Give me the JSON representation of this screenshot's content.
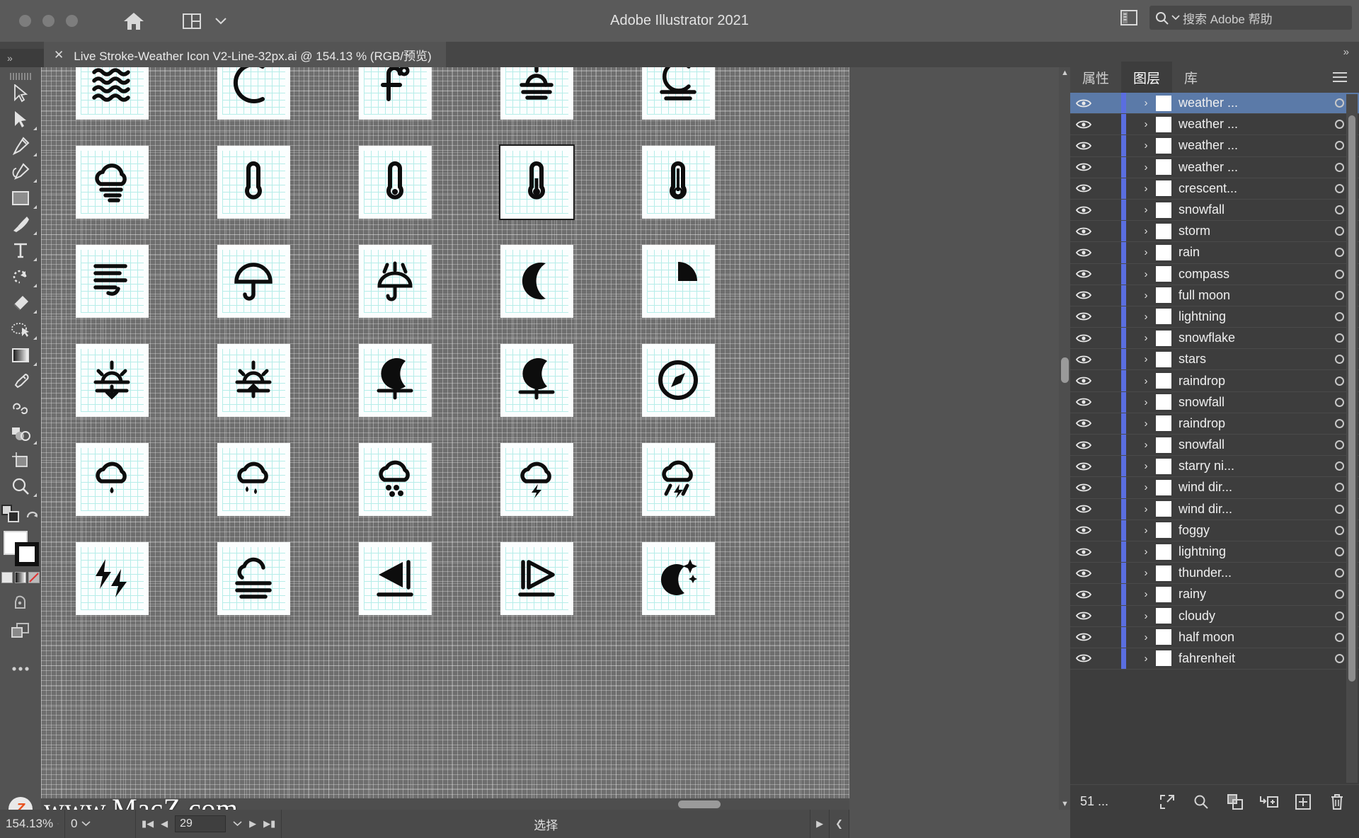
{
  "window": {
    "app_title": "Adobe Illustrator 2021",
    "traffic_lights": [
      "close",
      "minimize",
      "maximize"
    ],
    "home_icon": "home-icon",
    "arrange_icon": "arrange-documents-icon",
    "arrange_chevron": "chevron-down-icon",
    "panel_toggle_icon": "panel-toggle-icon"
  },
  "search": {
    "icon": "search-icon",
    "chevron": "chevron-down-icon",
    "placeholder": "搜索 Adobe 帮助"
  },
  "tabbar": {
    "collapse_label": "»",
    "document": {
      "close_icon": "close-icon",
      "title": "Live Stroke-Weather Icon V2-Line-32px.ai @ 154.13 % (RGB/预览)"
    }
  },
  "toolbar": {
    "tools": [
      {
        "name": "selection-tool",
        "glyph": "cursor",
        "has_flyout": false,
        "selected": false
      },
      {
        "name": "direct-selection-tool",
        "glyph": "cursor-filled",
        "has_flyout": true,
        "selected": false
      },
      {
        "name": "pen-tool",
        "glyph": "pen",
        "has_flyout": true,
        "selected": false
      },
      {
        "name": "curvature-tool",
        "glyph": "curvature",
        "has_flyout": true,
        "selected": false
      },
      {
        "name": "rectangle-tool",
        "glyph": "rectangle",
        "has_flyout": true,
        "selected": false
      },
      {
        "name": "paintbrush-tool",
        "glyph": "brush",
        "has_flyout": true,
        "selected": false
      },
      {
        "name": "type-tool",
        "glyph": "type",
        "has_flyout": true,
        "selected": false
      },
      {
        "name": "rotate-tool",
        "glyph": "rotate",
        "has_flyout": true,
        "selected": false
      },
      {
        "name": "eraser-tool",
        "glyph": "eraser",
        "has_flyout": true,
        "selected": false
      },
      {
        "name": "shaper-tool",
        "glyph": "shaper",
        "has_flyout": true,
        "selected": false
      },
      {
        "name": "gradient-tool",
        "glyph": "gradient",
        "has_flyout": true,
        "selected": false
      },
      {
        "name": "eyedropper-tool",
        "glyph": "eyedropper",
        "has_flyout": false,
        "selected": false
      },
      {
        "name": "blend-tool",
        "glyph": "blend",
        "has_flyout": false,
        "selected": false
      },
      {
        "name": "shape-builder-tool",
        "glyph": "shapebuilder",
        "has_flyout": true,
        "selected": false
      },
      {
        "name": "artboard-tool",
        "glyph": "artboard",
        "has_flyout": false,
        "selected": false
      },
      {
        "name": "zoom-tool",
        "glyph": "zoom",
        "has_flyout": true,
        "selected": false
      }
    ],
    "screen_mode_icon": "screen-mode-icon",
    "swap_icon": "swap-fill-stroke-icon",
    "fill_color": "#ffffff",
    "stroke_color": "#111111",
    "more_tools_icon": "more-tools-icon",
    "drawing_mode_icon": "drawing-mode-icon"
  },
  "canvas": {
    "icon_rows": [
      [
        {
          "name": "waves-icon",
          "glyph": "waves",
          "selected": false
        },
        {
          "name": "crescent-outline-icon",
          "glyph": "crescent-c",
          "selected": false
        },
        {
          "name": "fahrenheit-icon",
          "glyph": "fahrenheit",
          "selected": false
        },
        {
          "name": "sunrise-fog-icon",
          "glyph": "sun-lines",
          "selected": false
        },
        {
          "name": "moon-fog-icon",
          "glyph": "moon-lines",
          "selected": false
        }
      ],
      [
        {
          "name": "windy-cloud-icon",
          "glyph": "cloud-wind",
          "selected": false
        },
        {
          "name": "thermometer-icon",
          "glyph": "thermometer-empty",
          "selected": false
        },
        {
          "name": "thermometer-low-icon",
          "glyph": "thermometer-low",
          "selected": false
        },
        {
          "name": "thermometer-mid-icon",
          "glyph": "thermometer-mid",
          "selected": true
        },
        {
          "name": "thermometer-high-icon",
          "glyph": "thermometer-high",
          "selected": false
        }
      ],
      [
        {
          "name": "wind-direction-icon",
          "glyph": "wind-dir",
          "selected": false
        },
        {
          "name": "umbrella-icon",
          "glyph": "umbrella",
          "selected": false
        },
        {
          "name": "umbrella-rain-icon",
          "glyph": "umbrella-rain",
          "selected": false
        },
        {
          "name": "crescent-moon-icon",
          "glyph": "crescent",
          "selected": false
        },
        {
          "name": "waning-moon-icon",
          "glyph": "waning",
          "selected": false
        }
      ],
      [
        {
          "name": "sunrise-icon",
          "glyph": "sunrise",
          "selected": false
        },
        {
          "name": "sunset-icon",
          "glyph": "sunset",
          "selected": false
        },
        {
          "name": "moonrise-icon",
          "glyph": "moonrise",
          "selected": false
        },
        {
          "name": "moonset-icon",
          "glyph": "moonset",
          "selected": false
        },
        {
          "name": "compass-icon",
          "glyph": "compass",
          "selected": false
        }
      ],
      [
        {
          "name": "rain-cloud-icon",
          "glyph": "rain1",
          "selected": false
        },
        {
          "name": "rain-cloud-2-icon",
          "glyph": "rain2",
          "selected": false
        },
        {
          "name": "hail-cloud-icon",
          "glyph": "hail",
          "selected": false
        },
        {
          "name": "thunder-cloud-icon",
          "glyph": "thunder",
          "selected": false
        },
        {
          "name": "thunder-rain-icon",
          "glyph": "thunderrain",
          "selected": false
        }
      ],
      [
        {
          "name": "double-lightning-icon",
          "glyph": "dbllightning",
          "selected": false
        },
        {
          "name": "foggy-cloud-icon",
          "glyph": "foggy",
          "selected": false
        },
        {
          "name": "wind-left-icon",
          "glyph": "windleft",
          "selected": false
        },
        {
          "name": "wind-right-icon",
          "glyph": "windright",
          "selected": false
        },
        {
          "name": "starry-night-icon",
          "glyph": "starrynight",
          "selected": false
        }
      ]
    ]
  },
  "panel": {
    "collapse_icon": "collapse-panel-icon",
    "tabs": [
      {
        "label": "属性",
        "name": "tab-properties",
        "active": false
      },
      {
        "label": "图层",
        "name": "tab-layers",
        "active": true
      },
      {
        "label": "库",
        "name": "tab-libraries",
        "active": false
      }
    ],
    "menu_icon": "panel-menu-icon",
    "layers": [
      {
        "name": "weather ...",
        "visible": true,
        "selected": true
      },
      {
        "name": "weather ...",
        "visible": true,
        "selected": false
      },
      {
        "name": "weather ...",
        "visible": true,
        "selected": false
      },
      {
        "name": "weather ...",
        "visible": true,
        "selected": false
      },
      {
        "name": "crescent...",
        "visible": true,
        "selected": false
      },
      {
        "name": "snowfall",
        "visible": true,
        "selected": false
      },
      {
        "name": "storm",
        "visible": true,
        "selected": false
      },
      {
        "name": "rain",
        "visible": true,
        "selected": false
      },
      {
        "name": "compass",
        "visible": true,
        "selected": false
      },
      {
        "name": "full moon",
        "visible": true,
        "selected": false
      },
      {
        "name": "lightning",
        "visible": true,
        "selected": false
      },
      {
        "name": "snowflake",
        "visible": true,
        "selected": false
      },
      {
        "name": "stars",
        "visible": true,
        "selected": false
      },
      {
        "name": "raindrop",
        "visible": true,
        "selected": false
      },
      {
        "name": "snowfall",
        "visible": true,
        "selected": false
      },
      {
        "name": "raindrop",
        "visible": true,
        "selected": false
      },
      {
        "name": "snowfall",
        "visible": true,
        "selected": false
      },
      {
        "name": "starry ni...",
        "visible": true,
        "selected": false
      },
      {
        "name": "wind dir...",
        "visible": true,
        "selected": false
      },
      {
        "name": "wind dir...",
        "visible": true,
        "selected": false
      },
      {
        "name": "foggy",
        "visible": true,
        "selected": false
      },
      {
        "name": "lightning",
        "visible": true,
        "selected": false
      },
      {
        "name": "thunder...",
        "visible": true,
        "selected": false
      },
      {
        "name": "rainy",
        "visible": true,
        "selected": false
      },
      {
        "name": "cloudy",
        "visible": true,
        "selected": false
      },
      {
        "name": "half moon",
        "visible": true,
        "selected": false
      },
      {
        "name": "fahrenheit",
        "visible": true,
        "selected": false
      }
    ],
    "footer": {
      "count_label": "51 ...",
      "icons": [
        {
          "name": "locate-object-icon"
        },
        {
          "name": "search-layer-icon"
        },
        {
          "name": "make-clipping-mask-icon"
        },
        {
          "name": "new-sublayer-icon"
        },
        {
          "name": "new-layer-icon"
        },
        {
          "name": "delete-layer-icon"
        }
      ]
    }
  },
  "statusbar": {
    "zoom_level": "154.13%",
    "zoom_chevron": "chevron-down-icon",
    "rotation": "0",
    "rotation_chevron": "chevron-down-icon",
    "artboard_first_icon": "first-artboard-icon",
    "artboard_prev_icon": "prev-artboard-icon",
    "artboard_number": "29",
    "artboard_chevron": "chevron-down-icon",
    "artboard_next_icon": "next-artboard-icon",
    "artboard_last_icon": "last-artboard-icon",
    "tool_label": "选择",
    "nav_next_icon": "status-next-icon",
    "nav_prev_icon": "status-prev-icon"
  },
  "watermark": {
    "text": "www.MacZ.com",
    "logo": "macz-logo",
    "logo_letter": "Z"
  }
}
